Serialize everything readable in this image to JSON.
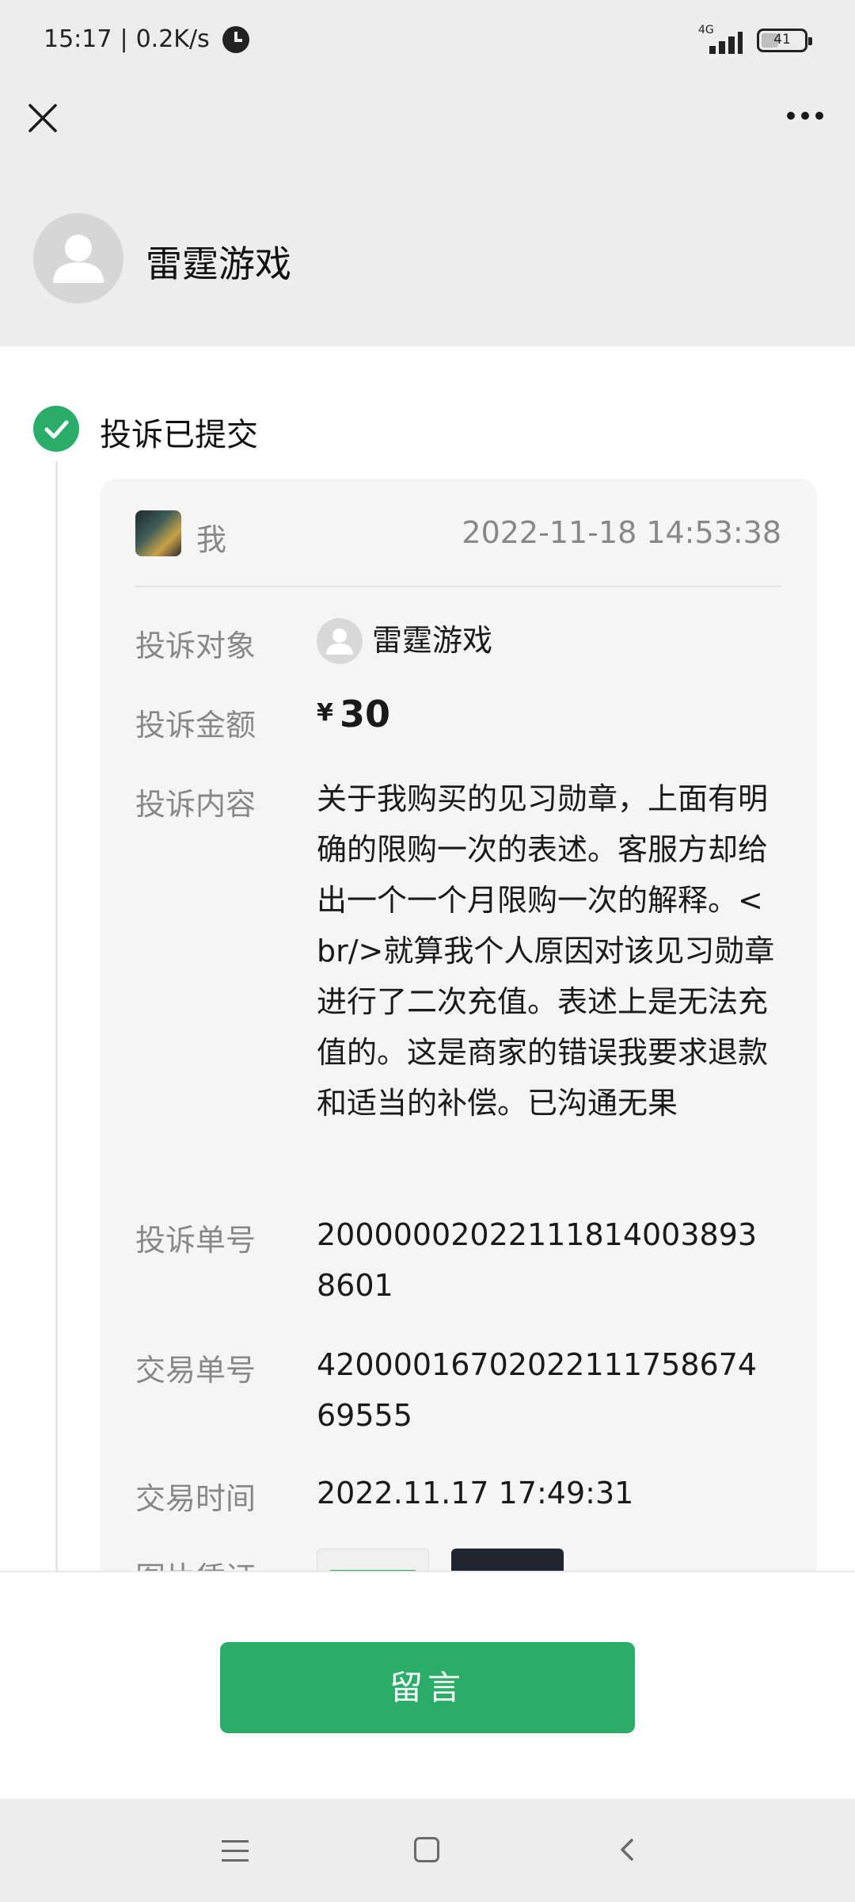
{
  "status_bar": {
    "time": "15:17",
    "separator": "|",
    "speed": "0.2K/s",
    "network": "4G",
    "battery": "41",
    "battery_level": 0.41
  },
  "header": {
    "close_icon": "close-icon",
    "more_icon": "more-icon"
  },
  "merchant": {
    "name": "雷霆游戏",
    "avatar_icon": "avatar-icon"
  },
  "complaint": {
    "status": "投诉已提交",
    "author": "我",
    "timestamp": "2022-11-18 14:53:38",
    "fields": {
      "target_label": "投诉对象",
      "target_value": "雷霆游戏",
      "amount_label": "投诉金额",
      "amount_currency": "¥",
      "amount_value": "30",
      "content_label": "投诉内容",
      "content_value": "关于我购买的见习勋章，上面有明确的限购一次的表述。客服方却给出一个一个月限购一次的解释。<br/>就算我个人原因对该见习勋章进行了二次充值。表述上是无法充值的。这是商家的错误我要求退款和适当的补偿。已沟通无果",
      "complaint_no_label": "投诉单号",
      "complaint_no_value": "200000020221118140038938601",
      "trade_no_label": "交易单号",
      "trade_no_value": "4200001670202211175867469555",
      "trade_time_label": "交易时间",
      "trade_time_value": "2022.11.17 17:49:31",
      "proof_label": "图片凭证"
    }
  },
  "actions": {
    "message_button": "留言"
  },
  "colors": {
    "accent": "#2aae67",
    "background_gray": "#ededed",
    "card_bg": "#f5f5f5",
    "label_gray": "#888888"
  }
}
